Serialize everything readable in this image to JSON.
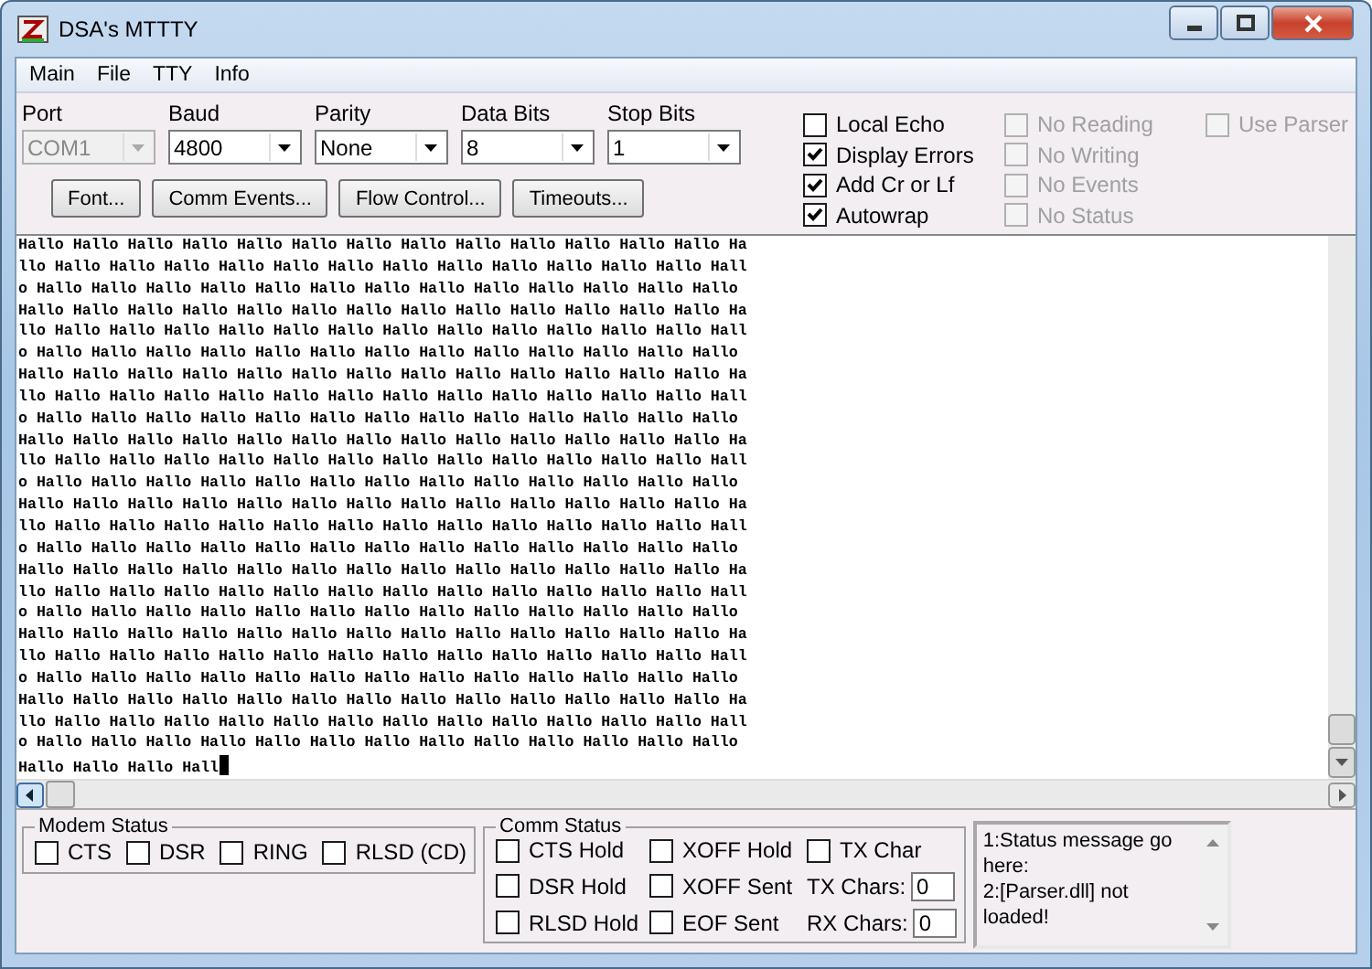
{
  "window": {
    "title": "DSA's MTTTY"
  },
  "menu": [
    "Main",
    "File",
    "TTY",
    "Info"
  ],
  "settings": [
    {
      "label": "Port",
      "value": "COM1",
      "disabled": true
    },
    {
      "label": "Baud",
      "value": "4800",
      "disabled": false
    },
    {
      "label": "Parity",
      "value": "None",
      "disabled": false
    },
    {
      "label": "Data Bits",
      "value": "8",
      "disabled": false
    },
    {
      "label": "Stop Bits",
      "value": "1",
      "disabled": false
    }
  ],
  "buttons": [
    "Font...",
    "Comm Events...",
    "Flow Control...",
    "Timeouts..."
  ],
  "option_columns": [
    [
      {
        "label": "Local Echo",
        "checked": false,
        "disabled": false
      },
      {
        "label": "Display Errors",
        "checked": true,
        "disabled": false
      },
      {
        "label": "Add Cr or Lf",
        "checked": true,
        "disabled": false
      },
      {
        "label": "Autowrap",
        "checked": true,
        "disabled": false
      }
    ],
    [
      {
        "label": "No Reading",
        "checked": false,
        "disabled": true
      },
      {
        "label": "No Writing",
        "checked": false,
        "disabled": true
      },
      {
        "label": "No Events",
        "checked": false,
        "disabled": true
      },
      {
        "label": "No Status",
        "checked": false,
        "disabled": true
      }
    ],
    [
      {
        "label": "Use Parser",
        "checked": false,
        "disabled": true
      }
    ]
  ],
  "terminal": {
    "lines": [
      "Hallo Hallo Hallo Hallo Hallo Hallo Hallo Hallo Hallo Hallo Hallo Hallo Hallo Ha",
      "llo Hallo Hallo Hallo Hallo Hallo Hallo Hallo Hallo Hallo Hallo Hallo Hallo Hall",
      "o Hallo Hallo Hallo Hallo Hallo Hallo Hallo Hallo Hallo Hallo Hallo Hallo Hallo",
      "Hallo Hallo Hallo Hallo Hallo Hallo Hallo Hallo Hallo Hallo Hallo Hallo Hallo Ha",
      "llo Hallo Hallo Hallo Hallo Hallo Hallo Hallo Hallo Hallo Hallo Hallo Hallo Hall",
      "o Hallo Hallo Hallo Hallo Hallo Hallo Hallo Hallo Hallo Hallo Hallo Hallo Hallo",
      "Hallo Hallo Hallo Hallo Hallo Hallo Hallo Hallo Hallo Hallo Hallo Hallo Hallo Ha",
      "llo Hallo Hallo Hallo Hallo Hallo Hallo Hallo Hallo Hallo Hallo Hallo Hallo Hall",
      "o Hallo Hallo Hallo Hallo Hallo Hallo Hallo Hallo Hallo Hallo Hallo Hallo Hallo",
      "Hallo Hallo Hallo Hallo Hallo Hallo Hallo Hallo Hallo Hallo Hallo Hallo Hallo Ha",
      "llo Hallo Hallo Hallo Hallo Hallo Hallo Hallo Hallo Hallo Hallo Hallo Hallo Hall",
      "o Hallo Hallo Hallo Hallo Hallo Hallo Hallo Hallo Hallo Hallo Hallo Hallo Hallo",
      "Hallo Hallo Hallo Hallo Hallo Hallo Hallo Hallo Hallo Hallo Hallo Hallo Hallo Ha",
      "llo Hallo Hallo Hallo Hallo Hallo Hallo Hallo Hallo Hallo Hallo Hallo Hallo Hall",
      "o Hallo Hallo Hallo Hallo Hallo Hallo Hallo Hallo Hallo Hallo Hallo Hallo Hallo",
      "Hallo Hallo Hallo Hallo Hallo Hallo Hallo Hallo Hallo Hallo Hallo Hallo Hallo Ha",
      "llo Hallo Hallo Hallo Hallo Hallo Hallo Hallo Hallo Hallo Hallo Hallo Hallo Hall",
      "o Hallo Hallo Hallo Hallo Hallo Hallo Hallo Hallo Hallo Hallo Hallo Hallo Hallo",
      "Hallo Hallo Hallo Hallo Hallo Hallo Hallo Hallo Hallo Hallo Hallo Hallo Hallo Ha",
      "llo Hallo Hallo Hallo Hallo Hallo Hallo Hallo Hallo Hallo Hallo Hallo Hallo Hall",
      "o Hallo Hallo Hallo Hallo Hallo Hallo Hallo Hallo Hallo Hallo Hallo Hallo Hallo",
      "Hallo Hallo Hallo Hallo Hallo Hallo Hallo Hallo Hallo Hallo Hallo Hallo Hallo Ha",
      "llo Hallo Hallo Hallo Hallo Hallo Hallo Hallo Hallo Hallo Hallo Hallo Hallo Hall",
      "o Hallo Hallo Hallo Hallo Hallo Hallo Hallo Hallo Hallo Hallo Hallo Hallo Hallo",
      "Hallo Hallo Hallo Hall"
    ]
  },
  "modem_status": {
    "title": "Modem Status",
    "items": [
      {
        "label": "CTS",
        "checked": false
      },
      {
        "label": "DSR",
        "checked": false
      },
      {
        "label": "RING",
        "checked": false
      },
      {
        "label": "RLSD (CD)",
        "checked": false
      }
    ]
  },
  "comm_status": {
    "title": "Comm Status",
    "items": [
      {
        "kind": "checkbox",
        "label": "CTS Hold",
        "checked": false
      },
      {
        "kind": "checkbox",
        "label": "XOFF Hold",
        "checked": false
      },
      {
        "kind": "checkbox",
        "label": "TX Char",
        "checked": false
      },
      {
        "kind": "checkbox",
        "label": "DSR Hold",
        "checked": false
      },
      {
        "kind": "checkbox",
        "label": "XOFF Sent",
        "checked": false
      },
      {
        "kind": "counter",
        "label": "TX Chars:",
        "value": "0"
      },
      {
        "kind": "checkbox",
        "label": "RLSD Hold",
        "checked": false
      },
      {
        "kind": "checkbox",
        "label": "EOF Sent",
        "checked": false
      },
      {
        "kind": "counter",
        "label": "RX Chars:",
        "value": "0"
      }
    ]
  },
  "status_messages": [
    "1:Status message go here:",
    "2:[Parser.dll] not loaded!"
  ]
}
